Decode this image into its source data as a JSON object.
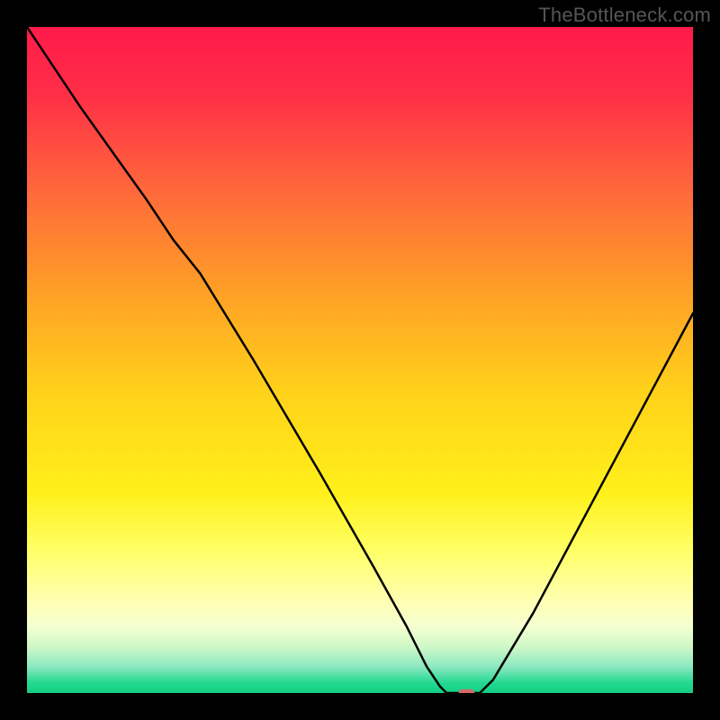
{
  "watermark": "TheBottleneck.com",
  "chart_data": {
    "type": "line",
    "title": "",
    "xlabel": "",
    "ylabel": "",
    "xlim": [
      0,
      100
    ],
    "ylim": [
      0,
      100
    ],
    "background_gradient": {
      "stops": [
        {
          "pos": 0.0,
          "color": "#ff1a4b"
        },
        {
          "pos": 0.1,
          "color": "#ff2e47"
        },
        {
          "pos": 0.25,
          "color": "#ff6a3a"
        },
        {
          "pos": 0.4,
          "color": "#ffa126"
        },
        {
          "pos": 0.55,
          "color": "#ffd21a"
        },
        {
          "pos": 0.7,
          "color": "#fff01a"
        },
        {
          "pos": 0.78,
          "color": "#ffff60"
        },
        {
          "pos": 0.86,
          "color": "#ffffb0"
        },
        {
          "pos": 0.9,
          "color": "#f5ffd0"
        },
        {
          "pos": 0.93,
          "color": "#d0f8c8"
        },
        {
          "pos": 0.96,
          "color": "#8de8c0"
        },
        {
          "pos": 0.985,
          "color": "#22d98f"
        },
        {
          "pos": 1.0,
          "color": "#12cf83"
        }
      ]
    },
    "series": [
      {
        "name": "bottleneck-curve",
        "color": "#000000",
        "points": [
          {
            "x": 0,
            "y": 100
          },
          {
            "x": 8,
            "y": 88
          },
          {
            "x": 18,
            "y": 74
          },
          {
            "x": 22,
            "y": 68
          },
          {
            "x": 26,
            "y": 63
          },
          {
            "x": 34,
            "y": 50
          },
          {
            "x": 44,
            "y": 33
          },
          {
            "x": 52,
            "y": 19
          },
          {
            "x": 57,
            "y": 10
          },
          {
            "x": 60,
            "y": 4
          },
          {
            "x": 62,
            "y": 1
          },
          {
            "x": 63,
            "y": 0
          },
          {
            "x": 68,
            "y": 0
          },
          {
            "x": 70,
            "y": 2
          },
          {
            "x": 76,
            "y": 12
          },
          {
            "x": 84,
            "y": 27
          },
          {
            "x": 92,
            "y": 42
          },
          {
            "x": 100,
            "y": 57
          }
        ]
      }
    ],
    "marker": {
      "name": "optimal-marker",
      "x": 66,
      "y": 0,
      "color": "#d46a6a",
      "width_pct": 2.4,
      "height_pct": 1.1
    }
  }
}
